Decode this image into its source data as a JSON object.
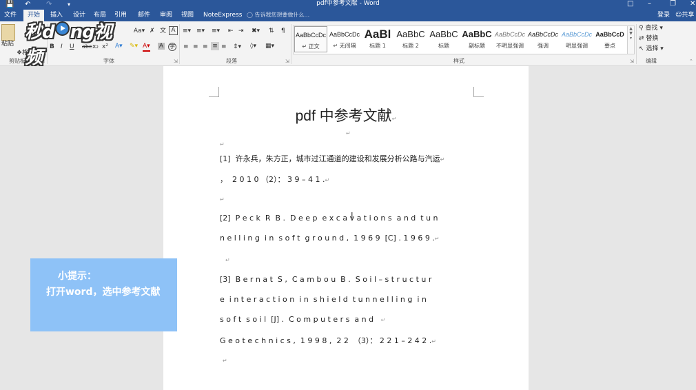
{
  "titlebar": {
    "save_icon": "save-icon",
    "undo_icon": "undo-icon",
    "redo_icon": "redo-icon",
    "title": "pdf中参考文献 - Word",
    "colors": {
      "word_blue": "#2b579a"
    }
  },
  "tabs": [
    "文件",
    "开始",
    "插入",
    "设计",
    "布局",
    "引用",
    "邮件",
    "审阅",
    "视图",
    "NoteExpress"
  ],
  "active_tab": "开始",
  "tell_me": "告诉我您想要做什么...",
  "login": "登录",
  "share": "共享",
  "ribbon": {
    "clipboard": {
      "label": "剪贴板",
      "paste": "粘贴",
      "format_painter": "格式刷"
    },
    "font": {
      "label": "字体",
      "bold": "B",
      "italic": "I",
      "underline": "U",
      "strike": "abc",
      "sub": "x₂",
      "sup": "x²"
    },
    "paragraph": {
      "label": "段落"
    },
    "styles": {
      "label": "样式",
      "items": [
        {
          "preview": "AaBbCcDc",
          "name": "↵ 正文"
        },
        {
          "preview": "AaBbCcDc",
          "name": "↵ 无间隔"
        },
        {
          "preview": "AaBl",
          "name": "标题 1"
        },
        {
          "preview": "AaBbC",
          "name": "标题 2"
        },
        {
          "preview": "AaBbC",
          "name": "标题"
        },
        {
          "preview": "AaBbC",
          "name": "副标题"
        },
        {
          "preview": "AaBbCcDc",
          "name": "不明显强调"
        },
        {
          "preview": "AaBbCcDc",
          "name": "强调"
        },
        {
          "preview": "AaBbCcDc",
          "name": "明显强调"
        },
        {
          "preview": "AaBbCcD",
          "name": "要点"
        }
      ]
    },
    "editing": {
      "label": "编辑",
      "find": "查找",
      "replace": "替换",
      "select": "选择"
    }
  },
  "watermark": {
    "part1": "秒",
    "part2": "d",
    "part3": "ng视频"
  },
  "document": {
    "title": "pdf 中参考文献",
    "lines": [
      "[1]  许永兵，朱方正，城市过江通道的建设和发展分析公路与汽运",
      "，  2 0 1 0 （2）： 3 9 – 4 1 .",
      "[2]  P e c k  R  B .  D e e p  e x c a v a t i o n s  a n d  t u n",
      "n e l l i n g  i n  s o f t  g r o u n d ,  1 9 6 9  [C] . 1 9 6 9 .",
      "[3]  B e r n a t  S ,  C a m b o u  B .  S o i l – s t r u c t u r",
      "e  i n t e r a c t i o n  i n  s h i e l d  t u n n e l l i n g  i n",
      "s o f t  s o i l  [J] .  C o m p u t e r s  a n d",
      "G e o t e c h n i c s ,  1 9 9 8 ,  2 2  （3）： 2 2 1 – 2 4 2 ."
    ],
    "para_mark": "↵"
  },
  "tip": {
    "line1": "小提示：",
    "line2": "打开word，选中参考文献"
  }
}
